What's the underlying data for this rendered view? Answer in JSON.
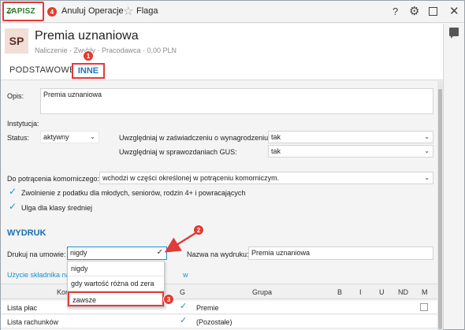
{
  "toolbar": {
    "save_label": "ZAPISZ",
    "save_badge": "4",
    "cancel_label": "Anuluj",
    "operations_label": "Operacje",
    "flag_label": "Flaga",
    "help_icon": "?"
  },
  "header": {
    "avatar": "SP",
    "title": "Premia uznaniowa",
    "subtitle": "Naliczenie  ·  Zwykły  ·  Pracodawca  ·  0,00 PLN"
  },
  "tabs": [
    {
      "label": "PODSTAWOWE"
    },
    {
      "label": "INNE",
      "badge": "1"
    }
  ],
  "form": {
    "opis_label": "Opis:",
    "opis_value": "Premia uznaniowa",
    "instytucja_label": "Instytucja:",
    "status_label": "Status:",
    "status_value": "aktywny",
    "zaswiadczenie_label": "Uwzględniaj w zaświadczeniu o wynagrodzeniu:",
    "zaswiadczenie_value": "tak",
    "gus_label": "Uwzględniaj w sprawozdaniach GUS:",
    "gus_value": "tak",
    "komornicze_label": "Do potrącenia komorniczego:",
    "komornicze_value": "wchodzi w części określonej w potrąceniu komorniczym.",
    "zwolnienie_label": "Zwolnienie z podatku dla młodych, seniorów, rodzin 4+ i powracających",
    "ulga_label": "Ulga dla klasy średniej"
  },
  "wydruk": {
    "section_title": "WYDRUK",
    "drukuj_label": "Drukuj na umowie:",
    "drukuj_value": "nigdy",
    "nazwa_label": "Nazwa na wydruku:",
    "nazwa_value": "Premia uznaniowa",
    "link_text_a": "Użycie składnika na",
    "link_text_b": "w",
    "dropdown_badge": "2",
    "options": [
      {
        "label": "nigdy"
      },
      {
        "label": "gdy wartość różna od zera"
      },
      {
        "label": "zawsze",
        "badge": "3"
      }
    ]
  },
  "table": {
    "columns": [
      "Kor",
      "G",
      "Grupa",
      "B",
      "I",
      "U",
      "ND",
      "M"
    ],
    "rows": [
      {
        "name": "Lista płac",
        "g": true,
        "grupa": "Premie",
        "m": false
      },
      {
        "name": "Lista rachunków",
        "g": true,
        "grupa": "(Pozostałe)",
        "m": null
      }
    ]
  },
  "colors": {
    "accent": "#1a7ac4",
    "save_green": "#2e7d32",
    "highlight_red": "#e03b3b",
    "checkbox_blue": "#1a8fd0"
  },
  "icons": [
    "check-icon",
    "star-icon",
    "help-icon",
    "gear-icon",
    "maximize-icon",
    "close-icon",
    "comment-icon",
    "chevron-down-icon"
  ]
}
